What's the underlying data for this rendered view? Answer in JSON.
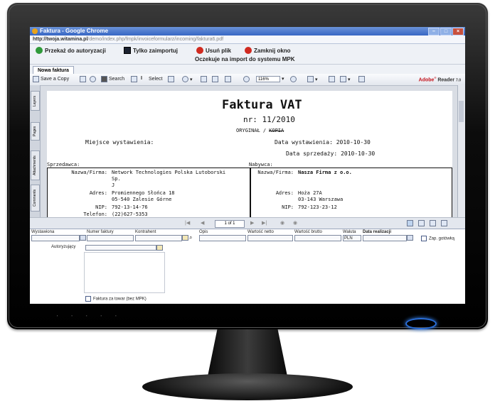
{
  "window": {
    "title": "Faktura - Google Chrome"
  },
  "url": {
    "host": "http://twoja.witamina.pl",
    "path": "/demo/index.php/fmpk/invoiceformularz/incoming/faktura6.pdf"
  },
  "toolbar": {
    "authorize": "Przekaż do autoryzacji",
    "import_only": "Tylko zaimportuj",
    "delete_file": "Usuń plik",
    "close_window": "Zamknij okno",
    "status": "Oczekuje na import do systemu MPK"
  },
  "tab": {
    "label": "Nowa faktura"
  },
  "reader": {
    "save_copy": "Save a Copy",
    "search": "Search",
    "select": "Select",
    "zoom": "116%",
    "brand": "Adobe",
    "brand_product": "Reader",
    "brand_version": "7.0",
    "sidebar_tabs": [
      "Layers",
      "Pages",
      "Attachments",
      "Comments"
    ],
    "page_indicator": "1 of 1"
  },
  "invoice": {
    "title": "Faktura VAT",
    "number": "nr: 11/2010",
    "original": "ORYGINAŁ /",
    "copy_struck": "KOPIA",
    "place_label": "Miejsce wystawienia:",
    "issue_date": "Data wystawienia: 2010-10-30",
    "sale_date": "Data sprzedaży: 2010-10-30",
    "seller_header": "Sprzedawca:",
    "buyer_header": "Nabywca:",
    "seller": {
      "name_label": "Nazwa/Firma:",
      "name_line1": "Network Technologies Polska Lutoborski",
      "name_line2": "Sp.",
      "name_line3": "J",
      "address_label": "Adres:",
      "address_line1": "Promiennego Słońca 18",
      "address_line2": "05-540 Zalesie Górne",
      "nip_label": "NIP:",
      "nip": "792-13-14-76",
      "phone_label": "Telefon:",
      "phone": "(22)627-5353"
    },
    "buyer": {
      "name_label": "Nazwa/Firma:",
      "name": "Nasza Firma z o.o.",
      "address_label": "Adres:",
      "address_line1": "Hoża 27A",
      "address_line2": "03-143 Warszawa",
      "nip_label": "NIP:",
      "nip": "792-123-23-12"
    }
  },
  "form": {
    "issued": "Wystawiona",
    "invoice_number": "Numer faktury",
    "contractor": "Kontrahent",
    "description": "Opis",
    "net_value": "Wartość netto",
    "gross_value": "Wartość brutto",
    "currency": "Waluta",
    "currency_value": "PLN",
    "realization_date": "Data realizacji",
    "cash_payment": "Zap. gotówką",
    "authorizing": "Autoryzujący",
    "goods_invoice": "Faktura za towar (bez MPK)"
  },
  "colors": {
    "accent": "#3766c4",
    "adobe_red": "#c4131b",
    "power_led": "#2a6ed8"
  }
}
